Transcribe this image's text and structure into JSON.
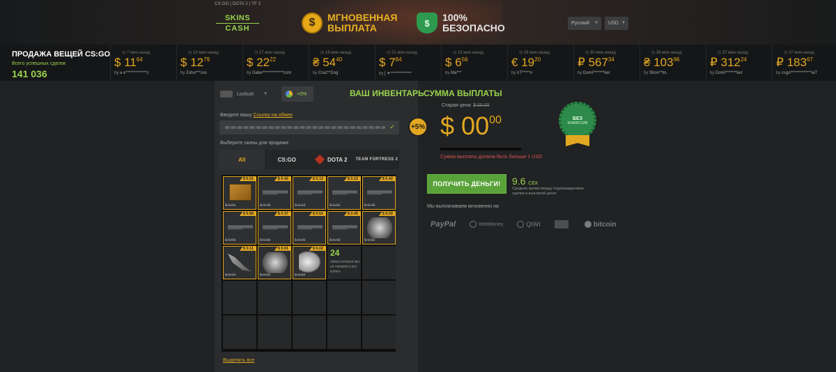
{
  "header": {
    "nav": "CS:GO  |  DOTA 2  |  TF 2",
    "logo_line1": "SKINS",
    "logo_line2": "CASH",
    "promo_instant_symbol": "$",
    "promo_instant_l1": "МГНОВЕННАЯ",
    "promo_instant_l2": "ВЫПЛАТА",
    "promo_safe_symbol": "$",
    "promo_safe_l1": "100%",
    "promo_safe_l2": "БЕЗОПАСНО",
    "language": "Русский",
    "currency": "USD"
  },
  "ticker": {
    "title": "ПРОДАЖА ВЕЩЕЙ CS:GO",
    "subtitle": "Всего успешных сделок",
    "count": "141 036",
    "sales": [
      {
        "time": "7 мин назад",
        "symbol": "$",
        "int": "11",
        "dec": "64",
        "by": "by",
        "user": "a e*************c"
      },
      {
        "time": "10 мин назад",
        "symbol": "$",
        "int": "12",
        "dec": "79",
        "by": "by",
        "user": "Zoha***sus"
      },
      {
        "time": "17 мин назад",
        "symbol": "$",
        "int": "22",
        "dec": "22",
        "by": "by",
        "user": "Gabe*************com"
      },
      {
        "time": "18 мин назад",
        "symbol": "₴",
        "int": "54",
        "dec": "40",
        "by": "by",
        "user": "Craz**Dog"
      },
      {
        "time": "21 мин назад",
        "symbol": "$",
        "int": "7",
        "dec": "84",
        "by": "by",
        "user": "[ ✦*************"
      },
      {
        "time": "23 мин назад",
        "symbol": "$",
        "int": "6",
        "dec": "56",
        "by": "by",
        "user": "Ma***"
      },
      {
        "time": "28 мин назад",
        "symbol": "€",
        "int": "19",
        "dec": "20",
        "by": "by",
        "user": "nT*****n"
      },
      {
        "time": "30 мин назад",
        "symbol": "₽",
        "int": "567",
        "dec": "34",
        "by": "by",
        "user": "Domi*******ker"
      },
      {
        "time": "36 мин назад",
        "symbol": "₴",
        "int": "103",
        "dec": "96",
        "by": "by",
        "user": "Shon**tis"
      },
      {
        "time": "37 мин назад",
        "symbol": "₽",
        "int": "312",
        "dec": "24",
        "by": "by",
        "user": "Domi*******ker"
      },
      {
        "time": "37 мин назад",
        "symbol": "₽",
        "int": "183",
        "dec": "67",
        "by": "by",
        "user": "csgo*************al7"
      }
    ]
  },
  "inventory": {
    "game_select": "Lockust",
    "bonus": "+0%",
    "title": "ВАШ ИНВЕНТАРЬ",
    "trade_label": "Введите вашу ",
    "trade_link": "Ссылку на обмен",
    "bonus_badge": "+5%",
    "choose_label": "Выберите скины для продажи:",
    "tabs": [
      "All",
      "CS:GO",
      "DOTA 2",
      "TEAM FORTRESS 2"
    ],
    "items": [
      {
        "price": "$ 0.01",
        "old": "$ 0.01",
        "kind": "case"
      },
      {
        "price": "$ 0.42",
        "old": "$ 0.48",
        "kind": "gun"
      },
      {
        "price": "$ 0.13",
        "old": "$ 0.13",
        "kind": "gun"
      },
      {
        "price": "$ 0.23",
        "old": "$ 0.22",
        "kind": "gun"
      },
      {
        "price": "$ 0.42",
        "old": "$ 0.48",
        "kind": "gun"
      },
      {
        "price": "$ 0.58",
        "old": "$ 0.55",
        "kind": "gun"
      },
      {
        "price": "$ 0.37",
        "old": "$ 0.35",
        "kind": "gun"
      },
      {
        "price": "$ 0.52",
        "old": "$ 0.49",
        "kind": "gun"
      },
      {
        "price": "$ 0.45",
        "old": "$ 0.43",
        "kind": "gun"
      },
      {
        "price": "$ 0.02",
        "old": "$ 0.02",
        "kind": "smoke"
      },
      {
        "price": "$ 0.11",
        "old": "$ 0.10",
        "kind": "knife"
      },
      {
        "price": "$ 0.01",
        "old": "$ 0.01",
        "kind": "smoke"
      },
      {
        "price": "$ 0.02",
        "old": "$ 0.02",
        "kind": "horn"
      }
    ],
    "unsellable_count": "24",
    "unsellable_text": "скина которые мы не сможем у вас купить",
    "select_all": "Выделить все"
  },
  "payout": {
    "title": "СУММА ВЫПЛАТЫ",
    "old_label": "Старая цена:",
    "old_value": "$ 00.00",
    "amount_symbol": "$",
    "amount_int": "00",
    "amount_dec": "00",
    "progress_fraction": 0,
    "min_warning": "Сумма выплаты должна быть больше 1 USD",
    "seal_main": "БЕЗ",
    "seal_sub": "КОМИССИИ",
    "button": "ПОЛУЧИТЬ ДЕНЬГИ!",
    "avg_time": "9.6",
    "avg_unit": "СЕК",
    "avg_desc": "Среднее время между подтверждением сделки и выплатой денег",
    "instant_label": "Мы выплачиваем мгновенно на",
    "methods": [
      "PayPal",
      "WebMoney",
      "QIWI",
      "",
      "bitcoin"
    ]
  }
}
